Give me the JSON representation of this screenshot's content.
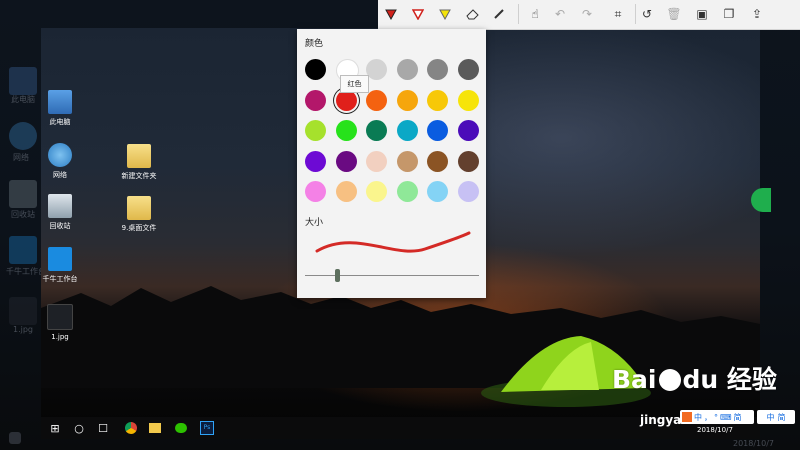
{
  "outer_desktop": {
    "icons": [
      {
        "label": "此电脑"
      },
      {
        "label": "网络"
      },
      {
        "label": "回收站"
      },
      {
        "label": "千牛工作台"
      },
      {
        "label": "1.jpg"
      }
    ],
    "taskbar_date": "2018/10/7"
  },
  "desktop": {
    "icons": [
      {
        "label": "此电脑",
        "icon": "computer-icon"
      },
      {
        "label": "网络",
        "icon": "network-icon"
      },
      {
        "label": "回收站",
        "icon": "recycle-bin-icon"
      },
      {
        "label": "千牛工作台",
        "icon": "qianniu-icon"
      },
      {
        "label": "1.jpg",
        "icon": "image-file-icon"
      },
      {
        "label": "新建文件夹",
        "icon": "folder-icon"
      },
      {
        "label": "9.桌面文件",
        "icon": "folder-icon"
      }
    ],
    "taskbar": {
      "date": "2018/10/7",
      "apps": [
        "start-icon",
        "cortana-icon",
        "task-view-icon",
        "chrome-icon",
        "file-explorer-icon",
        "wechat-icon",
        "photoshop-icon"
      ],
      "ps_label": "Ps"
    }
  },
  "toolbar": {
    "tools": [
      "pen-red-icon",
      "pen-red-outline-icon",
      "highlighter-yellow-icon",
      "eraser-icon",
      "ruler-icon",
      "touch-write-icon",
      "undo-icon",
      "redo-icon",
      "crop-icon",
      "history-icon",
      "delete-icon",
      "save-icon",
      "copy-icon",
      "share-icon"
    ]
  },
  "color_panel": {
    "title": "颜色",
    "tooltip": "红色",
    "selected_color": "#e0201b",
    "colors": [
      "#000000",
      "#ffffff",
      "#d3d3d3",
      "#a8a8a8",
      "#858585",
      "#5a5a5a",
      "#b3176a",
      "#e0201b",
      "#f46210",
      "#f6a60c",
      "#f7c808",
      "#f6e40a",
      "#a6e12c",
      "#27e21b",
      "#0a7b54",
      "#0ba8c6",
      "#0a5ce0",
      "#4b0cb9",
      "#6d0ad4",
      "#6a0a82",
      "#f2d0c0",
      "#c5976a",
      "#8b5424",
      "#63402e",
      "#f481e6",
      "#f7c082",
      "#faf58d",
      "#8fe898",
      "#84d3f5",
      "#c7c1f4"
    ],
    "size_label": "大小",
    "stroke_color": "#d42a26",
    "size_value": 0.19
  },
  "watermark": {
    "brand": "Bai",
    "brand2": "du",
    "cn": "经验",
    "sub": "jingyan"
  },
  "ime": {
    "items": [
      "中",
      "，",
      "°",
      "简",
      "中",
      "简"
    ]
  }
}
